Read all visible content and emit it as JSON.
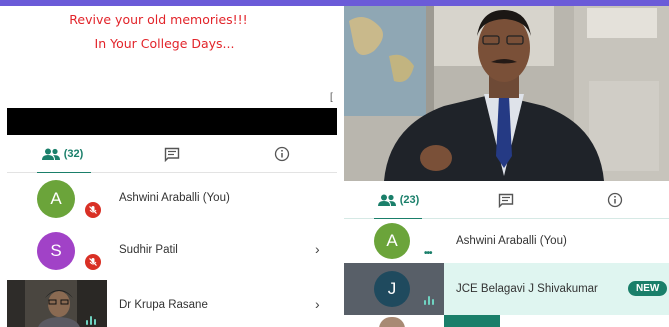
{
  "left_panel": {
    "banner": {
      "line1": "Revive your old memories!!!",
      "line2": "In Your College Days..."
    },
    "tabs": {
      "people_count": "(32)",
      "people_icon": "people-icon",
      "chat_icon": "chat-icon",
      "info_icon": "info-icon"
    },
    "participants": [
      {
        "initial": "A",
        "name": "Ashwini Araballi (You)",
        "avatar_color": "#6ba43a",
        "mic_muted": true
      },
      {
        "initial": "S",
        "name": "Sudhir Patil",
        "avatar_color": "#a142c7",
        "mic_muted": true
      },
      {
        "initial": "",
        "name": "Dr Krupa Rasane",
        "avatar_color": "#3d3a36",
        "mic_muted": false
      }
    ]
  },
  "right_panel": {
    "tabs": {
      "people_count": "(23)",
      "people_icon": "people-icon",
      "chat_icon": "chat-icon",
      "info_icon": "info-icon"
    },
    "participants": [
      {
        "initial": "A",
        "name": "Ashwini Araballi (You)",
        "avatar_color": "#6ba43a"
      },
      {
        "initial": "J",
        "name": "JCE Belagavi J Shivakumar",
        "avatar_color": "#1f4a5e",
        "badge": "NEW"
      }
    ]
  },
  "colors": {
    "accent": "#1a7f6a",
    "banner_text": "#e2242a",
    "mic_off": "#d93025",
    "top_bar": "#6b5bd8"
  }
}
